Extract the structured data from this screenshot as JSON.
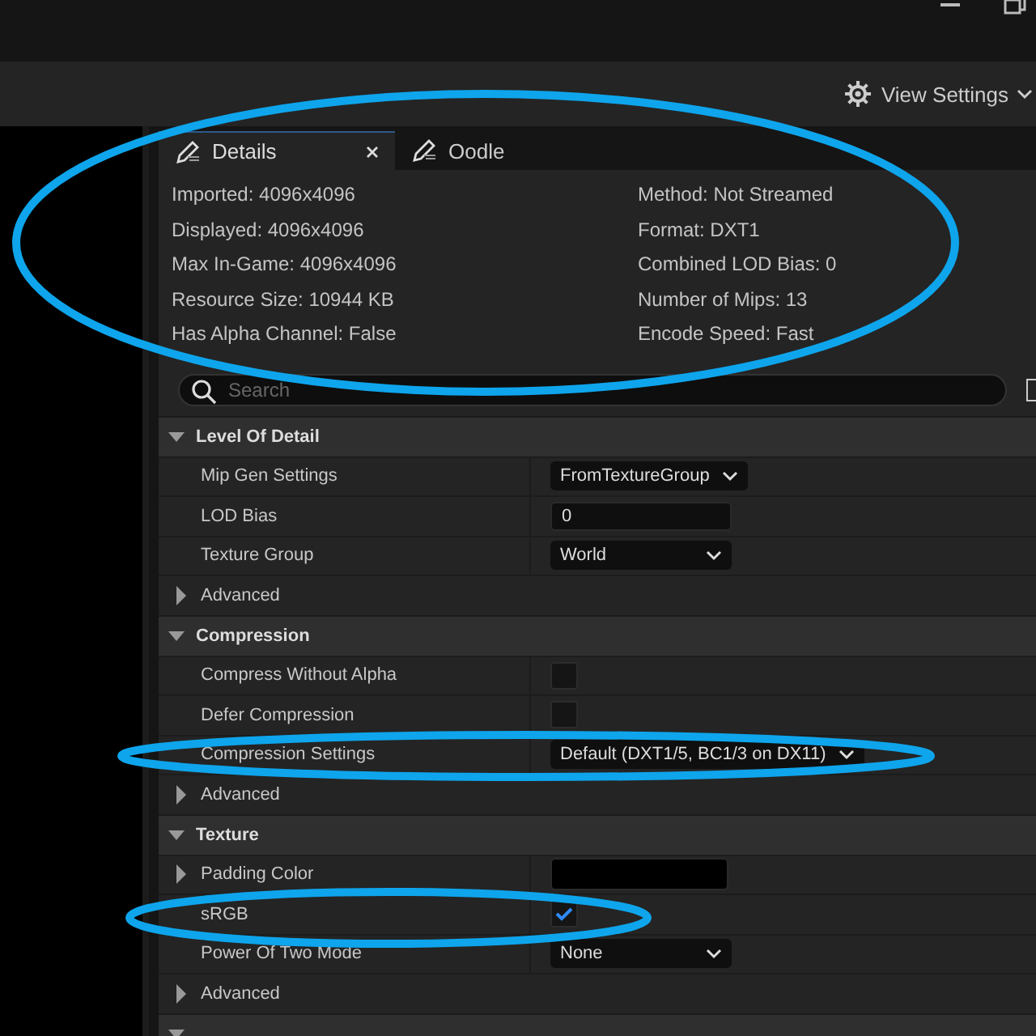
{
  "toolbar": {
    "view_settings": "View Settings"
  },
  "tabs": [
    {
      "label": "Details",
      "selected": true,
      "closable": true
    },
    {
      "label": "Oodle",
      "selected": false,
      "closable": false
    }
  ],
  "info_left": [
    "Imported: 4096x4096",
    "Displayed: 4096x4096",
    "Max In-Game: 4096x4096",
    "Resource Size: 10944 KB",
    "Has Alpha Channel: False"
  ],
  "info_right": [
    "Method: Not Streamed",
    "Format: DXT1",
    "Combined LOD Bias: 0",
    "Number of Mips: 13",
    "Encode Speed: Fast"
  ],
  "search": {
    "placeholder": "Search"
  },
  "sections": [
    {
      "title": "Level Of Detail",
      "expanded": true,
      "rows": [
        {
          "kind": "dropdown",
          "label": "Mip Gen Settings",
          "value": "FromTextureGroup"
        },
        {
          "kind": "text",
          "label": "LOD Bias",
          "value": "0"
        },
        {
          "kind": "dropdown",
          "label": "Texture Group",
          "value": "World"
        },
        {
          "kind": "group",
          "label": "Advanced",
          "expanded": false
        }
      ]
    },
    {
      "title": "Compression",
      "expanded": true,
      "rows": [
        {
          "kind": "checkbox",
          "label": "Compress Without Alpha",
          "checked": false
        },
        {
          "kind": "checkbox",
          "label": "Defer Compression",
          "checked": false
        },
        {
          "kind": "dropdown",
          "label": "Compression Settings",
          "value": "Default (DXT1/5, BC1/3 on DX11)"
        },
        {
          "kind": "group",
          "label": "Advanced",
          "expanded": false
        }
      ]
    },
    {
      "title": "Texture",
      "expanded": true,
      "rows": [
        {
          "kind": "color",
          "label": "Padding Color",
          "color": "#000000",
          "expanded": false
        },
        {
          "kind": "checkbox",
          "label": "sRGB",
          "checked": true
        },
        {
          "kind": "dropdown",
          "label": "Power Of Two Mode",
          "value": "None"
        },
        {
          "kind": "group",
          "label": "Advanced",
          "expanded": false
        }
      ]
    },
    {
      "expanded": true
    }
  ]
}
